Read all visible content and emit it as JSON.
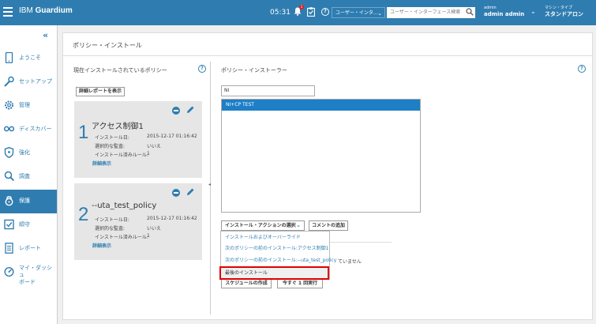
{
  "header": {
    "brand_prefix": "IBM ",
    "brand_name": "Guardium",
    "clock": "05:31",
    "alert_count": "1",
    "help_glyph": "?",
    "scope_select": "ユーザー・インタ...",
    "search_placeholder": "ユーザー・インターフェース検索",
    "user_role": "admin",
    "user_name": "admin admin",
    "mode_label": "マシン・タイプ",
    "mode_value": "スタンドアロン",
    "accent_color": "#2f7db0"
  },
  "sidebar": {
    "collapse_glyph": "«",
    "items": [
      {
        "label": "ようこそ",
        "icon": "tablet-icon"
      },
      {
        "label": "セットアップ",
        "icon": "wrench-icon"
      },
      {
        "label": "管理",
        "icon": "gear-icon"
      },
      {
        "label": "ディスカバー",
        "icon": "glasses-icon"
      },
      {
        "label": "強化",
        "icon": "shield-icon"
      },
      {
        "label": "調査",
        "icon": "search-icon"
      },
      {
        "label": "保護",
        "icon": "lock-icon",
        "active": true
      },
      {
        "label": "順守",
        "icon": "checkbox-icon"
      },
      {
        "label": "レポート",
        "icon": "document-icon"
      },
      {
        "label_line1": "マイ・ダッシュ",
        "label_line2": "ボード",
        "icon": "dashboard-icon"
      }
    ]
  },
  "page": {
    "title": "ポリシー・インストール"
  },
  "installed": {
    "title": "現在インストールされているポリシー",
    "detail_report_button": "詳細レポートを表示",
    "field_installed": "インストール日:",
    "field_selective": "選択的な監査:",
    "field_rules": "インストール済みルール:",
    "more_link": "詳細表示",
    "policies": [
      {
        "order": "1",
        "name": "アクセス制御1",
        "installed": "2015-12-17 01:16:42",
        "selective": "いいえ",
        "rules": "1"
      },
      {
        "order": "2",
        "name": "--uta_test_policy",
        "installed": "2015-12-17 01:16:42",
        "selective": "いいえ",
        "rules": "1"
      }
    ]
  },
  "installer": {
    "title": "ポリシー・インストーラー",
    "filter_value": "NI",
    "list_items": [
      "NI+CP TEST"
    ],
    "action_select": "インストール・アクションの選択",
    "comment_button": "コメントの追加",
    "schedule_button": "スケジュールの作成",
    "run_once_button": "今すぐ 1 回実行",
    "partial_text": "ていません",
    "dropdown_items": [
      "インストールおよびオーバーライド",
      "次のポリシーの前のインストール:アクセス制御1",
      "次のポリシーの前のインストール:--uta_test_policy",
      "最後のインストール"
    ],
    "highlight_color": "#e00000"
  }
}
